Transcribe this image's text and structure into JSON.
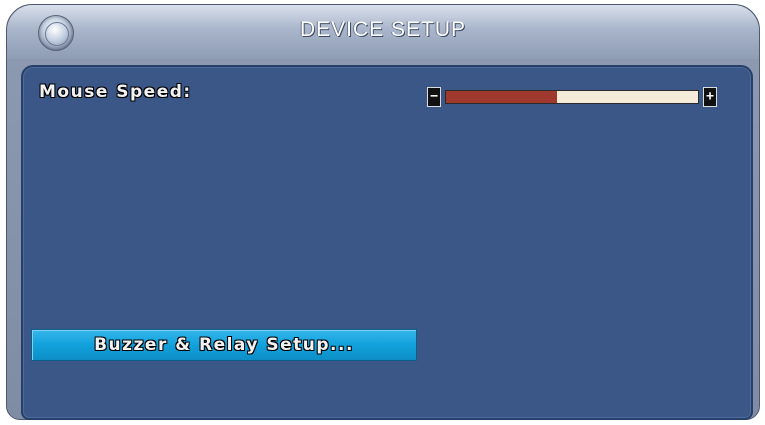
{
  "window": {
    "title": "DEVICE SETUP"
  },
  "settings": {
    "mouse_speed": {
      "label": "Mouse Speed:",
      "minus_symbol": "−",
      "plus_symbol": "+",
      "value_fraction": 0.44
    }
  },
  "actions": {
    "buzzer_relay_label": "Buzzer & Relay Setup..."
  },
  "colors": {
    "panel_bg": "#3a5788",
    "slider_fill": "#a0392d",
    "slider_track": "#f4ecd8",
    "button_bg": "#12a1dc"
  },
  "icons": {
    "title_orb": "window-orb-icon"
  }
}
